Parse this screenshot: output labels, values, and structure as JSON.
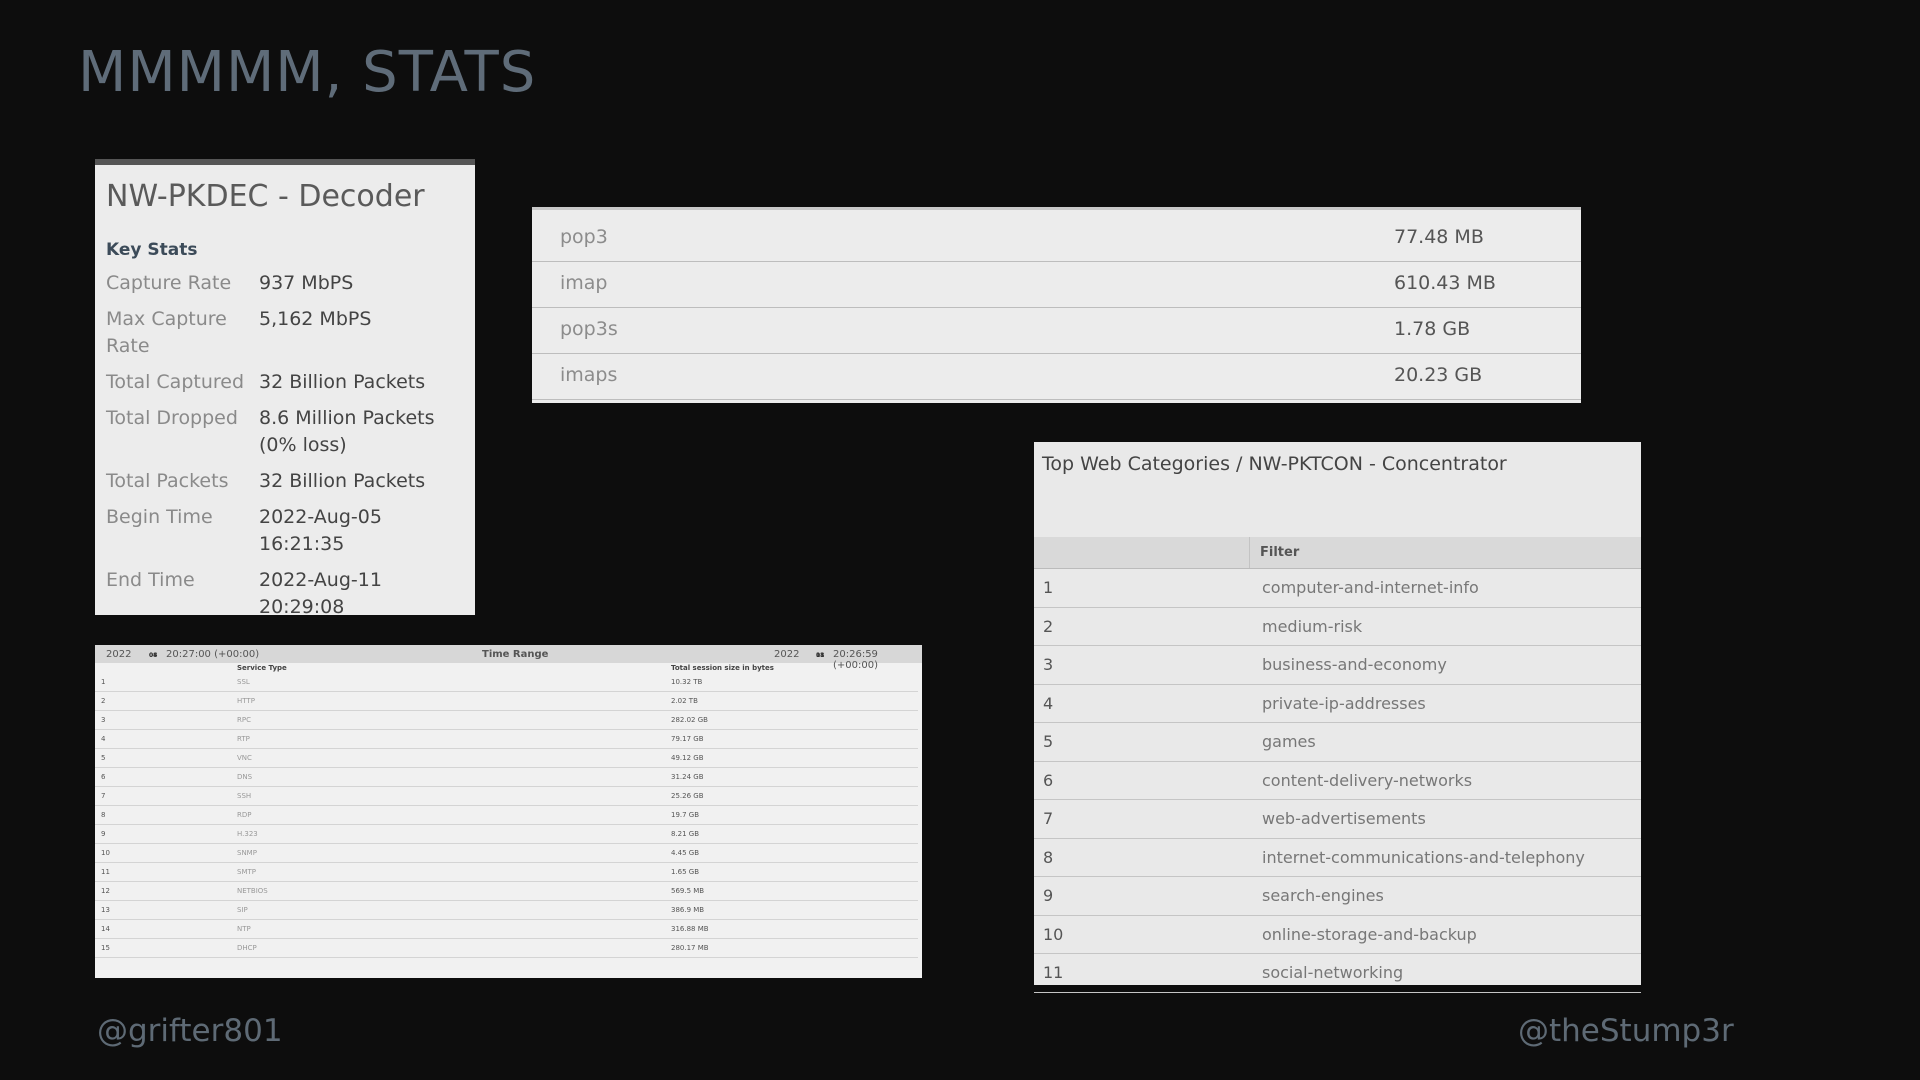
{
  "slide": {
    "title": "MMMMM, STATS",
    "footer_left": "@grifter801",
    "footer_right": "@theStump3r"
  },
  "decoder": {
    "title": "NW-PKDEC - Decoder",
    "section": "Key Stats",
    "stats": [
      {
        "label": "Capture Rate",
        "value": "937 MbPS"
      },
      {
        "label": "Max Capture Rate",
        "value": "5,162 MbPS"
      },
      {
        "label": "Total Captured",
        "value": "32 Billion Packets"
      },
      {
        "label": "Total Dropped",
        "value": "8.6 Million Packets (0% loss)"
      },
      {
        "label": "Total Packets",
        "value": "32 Billion Packets"
      },
      {
        "label": "Begin Time",
        "value": "2022-Aug-05 16:21:35"
      },
      {
        "label": "End Time",
        "value": "2022-Aug-11 20:29:08"
      }
    ]
  },
  "protocols": [
    {
      "name": "pop3",
      "size": "77.48 MB"
    },
    {
      "name": "imap",
      "size": "610.43 MB"
    },
    {
      "name": "pop3s",
      "size": "1.78 GB"
    },
    {
      "name": "imaps",
      "size": "20.23 GB"
    }
  ],
  "service_table": {
    "start_year": "2022",
    "start_cal": [
      "08",
      "04"
    ],
    "start_time": "20:27:00 (+00:00)",
    "range_label": "Time Range",
    "end_year": "2022",
    "end_cal": [
      "08",
      "11"
    ],
    "end_time": "20:26:59 (+00:00)",
    "col_service": "Service Type",
    "col_total": "Total session size in bytes",
    "rows": [
      {
        "n": "1",
        "service": "SSL",
        "total": "10.32 TB"
      },
      {
        "n": "2",
        "service": "HTTP",
        "total": "2.02 TB"
      },
      {
        "n": "3",
        "service": "RPC",
        "total": "282.02 GB"
      },
      {
        "n": "4",
        "service": "RTP",
        "total": "79.17 GB"
      },
      {
        "n": "5",
        "service": "VNC",
        "total": "49.12 GB"
      },
      {
        "n": "6",
        "service": "DNS",
        "total": "31.24 GB"
      },
      {
        "n": "7",
        "service": "SSH",
        "total": "25.26 GB"
      },
      {
        "n": "8",
        "service": "RDP",
        "total": "19.7 GB"
      },
      {
        "n": "9",
        "service": "H.323",
        "total": "8.21 GB"
      },
      {
        "n": "10",
        "service": "SNMP",
        "total": "4.45 GB"
      },
      {
        "n": "11",
        "service": "SMTP",
        "total": "1.65 GB"
      },
      {
        "n": "12",
        "service": "NETBIOS",
        "total": "569.5 MB"
      },
      {
        "n": "13",
        "service": "SIP",
        "total": "386.9 MB"
      },
      {
        "n": "14",
        "service": "NTP",
        "total": "316.88 MB"
      },
      {
        "n": "15",
        "service": "DHCP",
        "total": "280.17 MB"
      }
    ]
  },
  "web_categories": {
    "title": "Top Web Categories / NW-PKTCON - Concentrator",
    "col_filter": "Filter",
    "rows": [
      {
        "n": "1",
        "category": "computer-and-internet-info"
      },
      {
        "n": "2",
        "category": "medium-risk"
      },
      {
        "n": "3",
        "category": "business-and-economy"
      },
      {
        "n": "4",
        "category": "private-ip-addresses"
      },
      {
        "n": "5",
        "category": "games"
      },
      {
        "n": "6",
        "category": "content-delivery-networks"
      },
      {
        "n": "7",
        "category": "web-advertisements"
      },
      {
        "n": "8",
        "category": "internet-communications-and-telephony"
      },
      {
        "n": "9",
        "category": "search-engines"
      },
      {
        "n": "10",
        "category": "online-storage-and-backup"
      },
      {
        "n": "11",
        "category": "social-networking"
      }
    ]
  }
}
